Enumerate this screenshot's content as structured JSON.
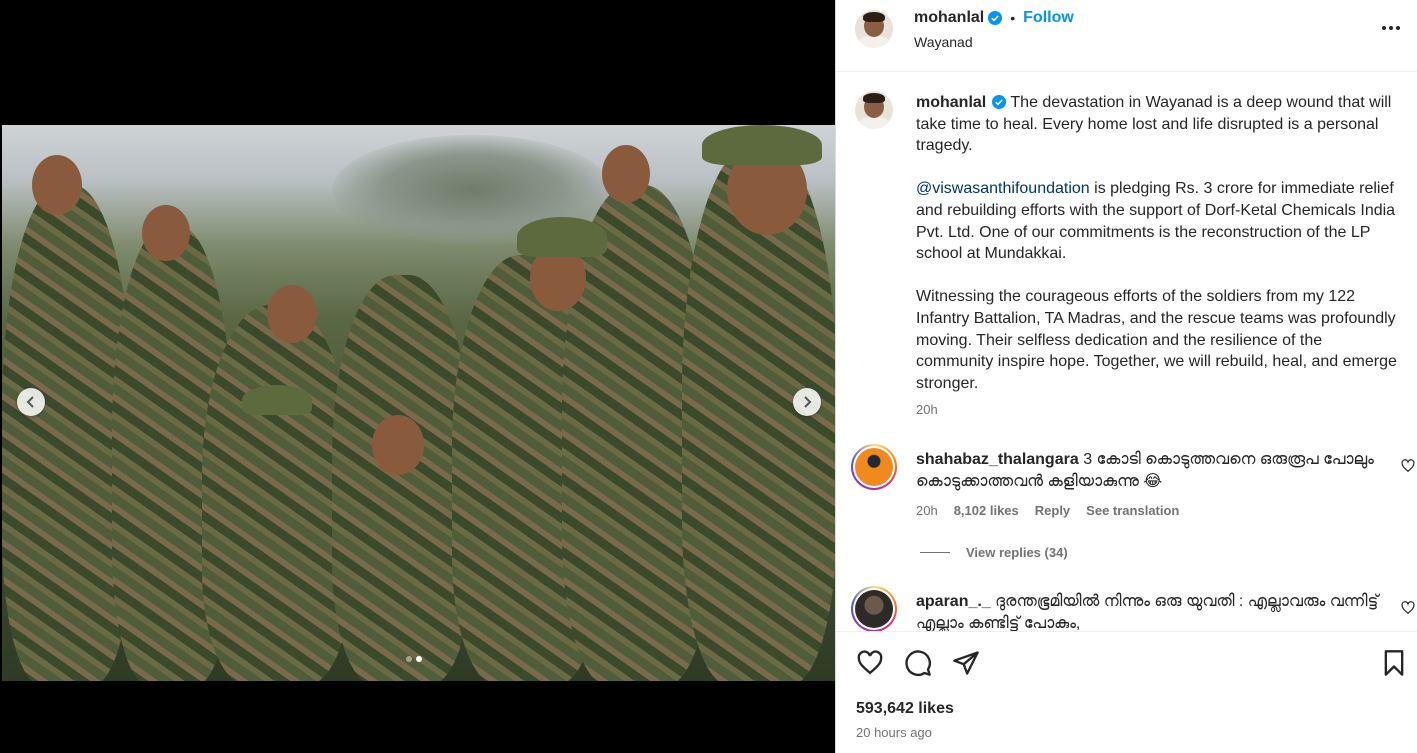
{
  "post": {
    "username": "mohanlal",
    "follow_label": "Follow",
    "separator": "•",
    "location": "Wayanad",
    "caption": {
      "username": "mohanlal",
      "para1": "The devastation in Wayanad is a deep wound that will take time to heal. Every home lost and life disrupted is a personal tragedy.",
      "mention": "@viswasanthifoundation",
      "para2_rest": " is pledging Rs. 3 crore for immediate relief and rebuilding efforts with the support of Dorf-Ketal Chemicals India Pvt. Ltd. One of our commitments is the reconstruction of the LP school at Mundakkai.",
      "para3": "Witnessing the courageous efforts of the soldiers from my 122 Infantry Battalion, TA Madras, and the rescue teams was profoundly moving. Their selfless dedication and the resilience of the community inspire hope. Together, we will rebuild, heal, and emerge stronger."
    },
    "caption_time": "20h",
    "likes": "593,642 likes",
    "posted": "20 hours ago",
    "carousel_dots": 2,
    "carousel_active": 1
  },
  "comments": [
    {
      "username": "shahabaz_thalangara",
      "text": "3 കോടി കൊടുത്തവനെ ഒരുരൂപ പോലും കൊടുക്കാത്തവൻ കളിയാകുന്നു 😂",
      "time": "20h",
      "likes": "8,102 likes",
      "reply": "Reply",
      "translate": "See translation",
      "view_replies": "View replies (34)"
    },
    {
      "username": "aparan_._",
      "text": "ദുരന്തഭൂമിയിൽ നിന്നും ഒരു യുവതി : എല്ലാവരും വന്നിട്ട് എല്ലാം കണ്ടിട്ട് പോകും,"
    }
  ],
  "colors": {
    "link_blue": "#0095f6",
    "mention_blue": "#00376b",
    "secondary_text": "#737373",
    "verified_blue": "#0095f6"
  }
}
